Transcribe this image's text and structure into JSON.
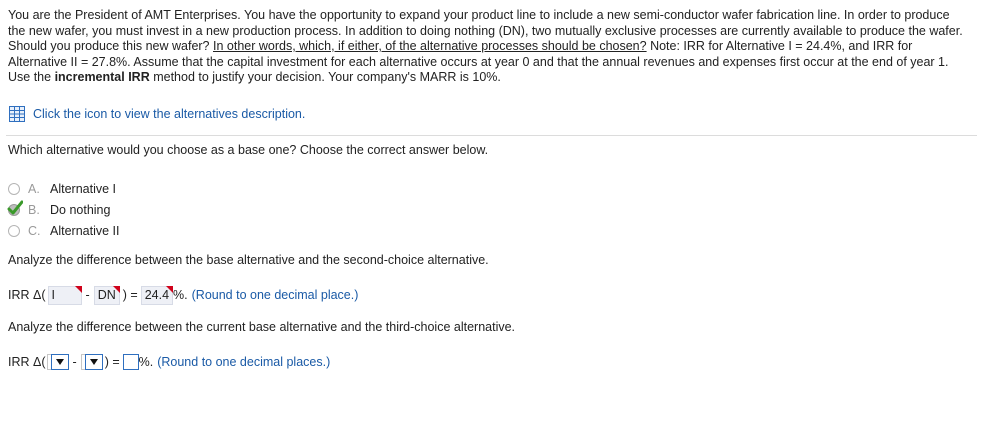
{
  "problem": {
    "p1": "You are the President of AMT Enterprises. You have the opportunity to expand your product line to include a new semi-conductor wafer fabrication line. In order to produce the new wafer, you must invest in a new production process. In addition to doing nothing (DN), two mutually exclusive processes are currently available to produce the wafer. Should you produce this new wafer? ",
    "underlined": "In other words, which, if either, of the alternative processes should be chosen?",
    "p2": " Note: IRR for Alternative I = 24.4%, and IRR for Alternative II = 27.8%. Assume that the capital investment for each alternative occurs at year 0 and that the annual revenues and expenses first occur at the end of year 1. Use the ",
    "bold": "incremental IRR",
    "p3": " method to justify your decision. Your company's MARR is 10%."
  },
  "link": {
    "text": "Click the icon to view the alternatives description."
  },
  "question1": {
    "prompt": "Which alternative would you choose as a base one? Choose the correct answer below.",
    "options": [
      {
        "letter": "A.",
        "text": "Alternative I",
        "selected": false
      },
      {
        "letter": "B.",
        "text": "Do nothing",
        "selected": true
      },
      {
        "letter": "C.",
        "text": "Alternative II",
        "selected": false
      }
    ]
  },
  "question2": {
    "prompt": "Analyze the difference between the base alternative and the second-choice alternative.",
    "label": "IRR Δ(",
    "first": "I",
    "minus": "-",
    "second": "DN",
    "close_eq": ") =",
    "value": "24.4",
    "percent": "%.",
    "note": "(Round to one decimal place.)"
  },
  "question3": {
    "prompt": "Analyze the difference between the current base alternative and the third-choice alternative.",
    "label": "IRR Δ(",
    "minus": "-",
    "close_eq": ") =",
    "percent": "%.",
    "note": "(Round to one decimal places.)"
  },
  "colors": {
    "link": "#1a5aa6",
    "incorrect_flag": "#d0021b",
    "correct_check": "#3a9a2a"
  }
}
